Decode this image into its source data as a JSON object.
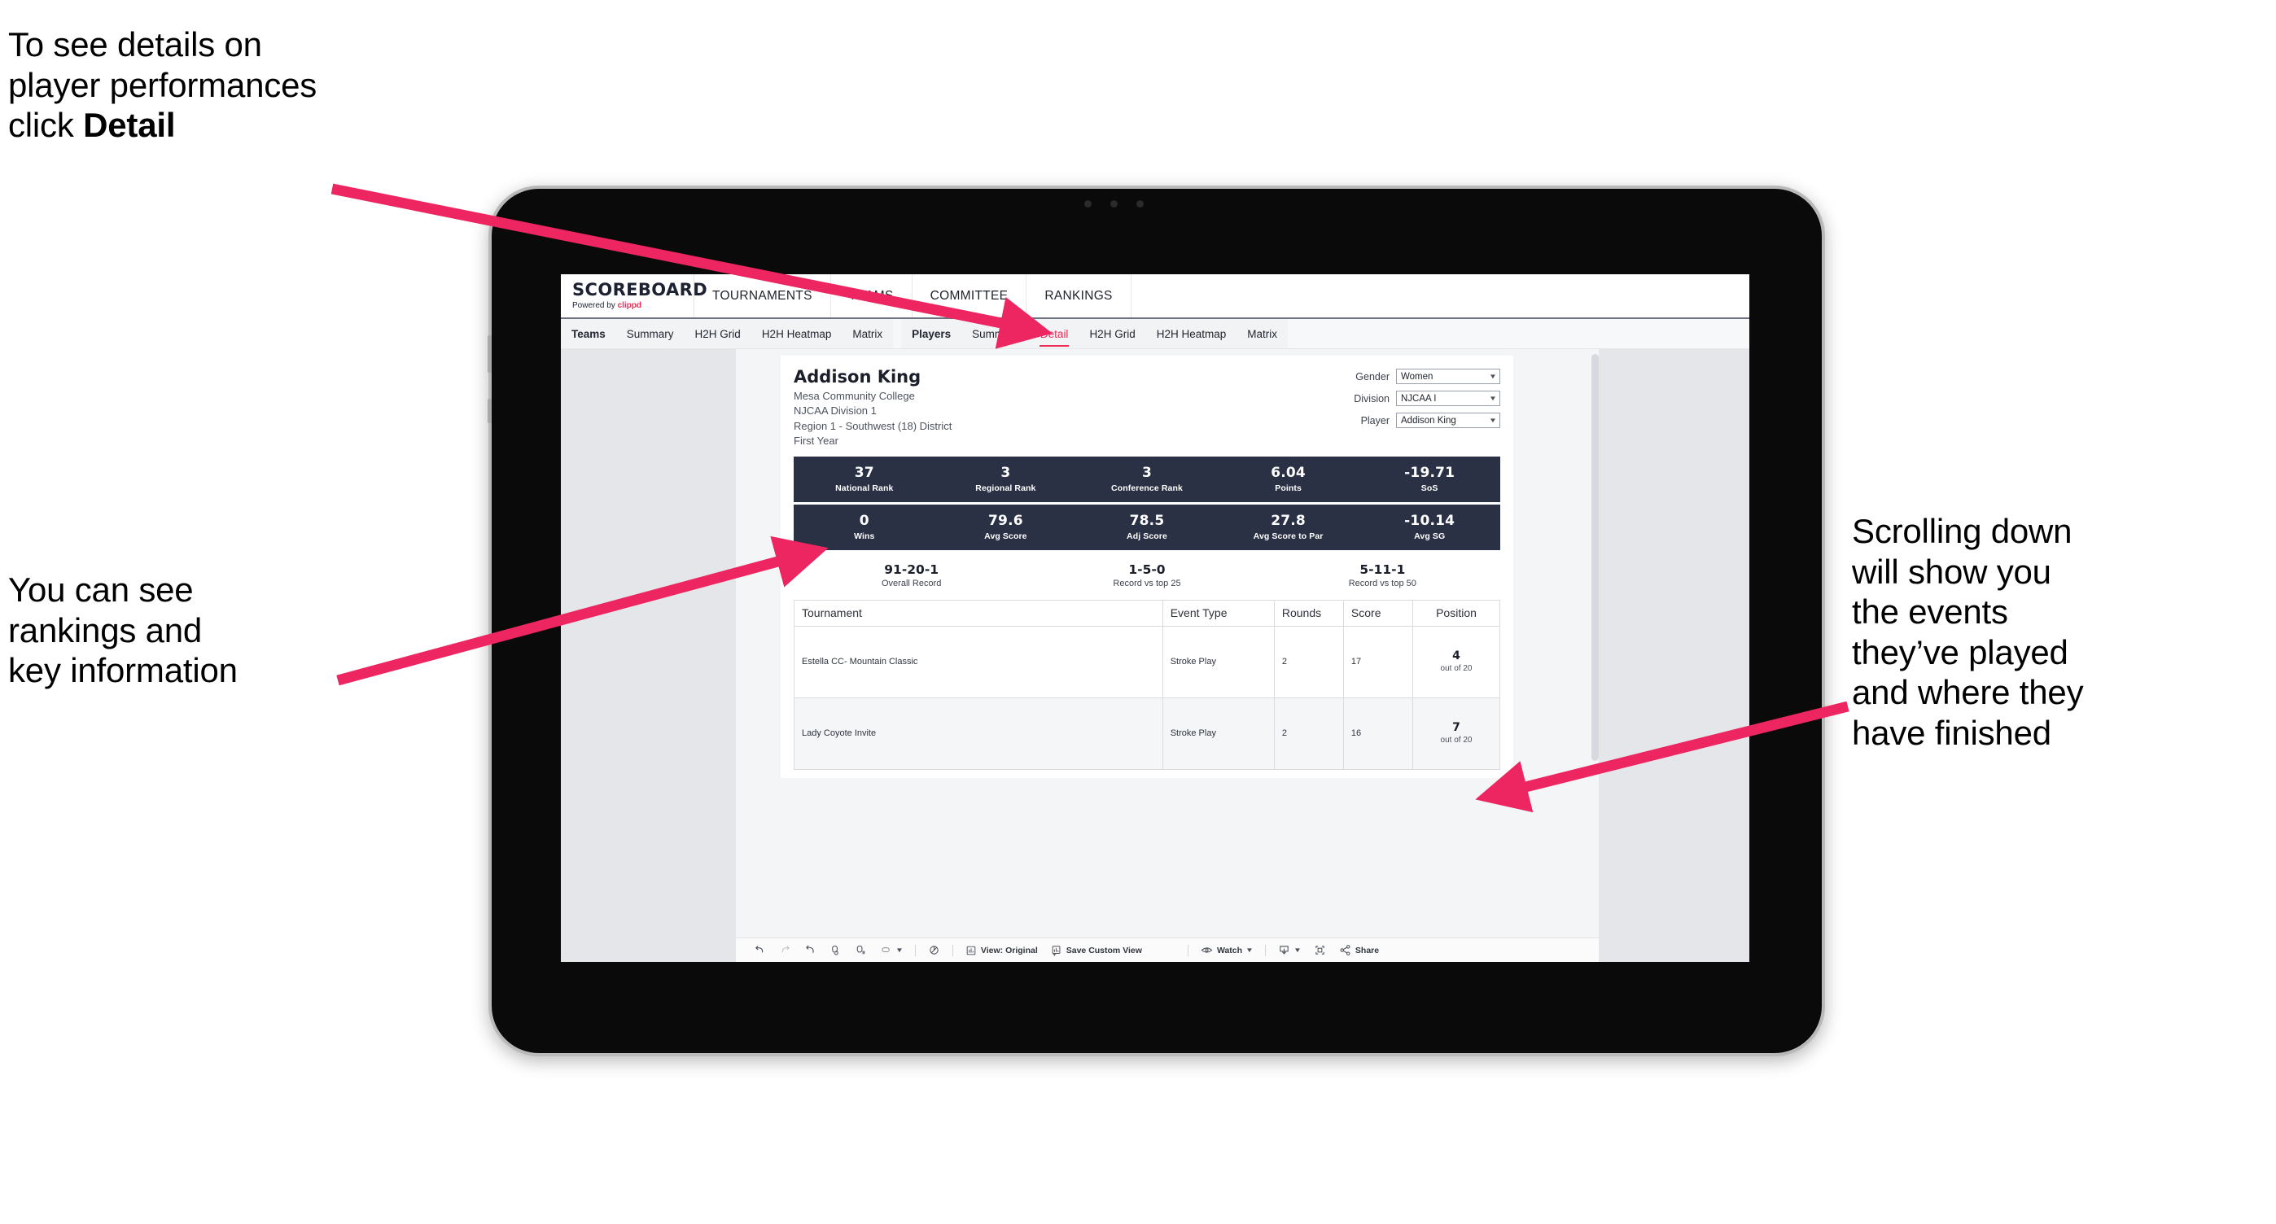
{
  "annotations": {
    "detail_line1": "To see details on",
    "detail_line2": "player performances",
    "detail_line3_pre": "click ",
    "detail_line3_bold": "Detail",
    "rankings_line1": "You can see",
    "rankings_line2": "rankings and",
    "rankings_line3": "key information",
    "scrolling_line1": "Scrolling down",
    "scrolling_line2": "will show you",
    "scrolling_line3": "the events",
    "scrolling_line4": "they’ve played",
    "scrolling_line5": "and where they",
    "scrolling_line6": "have finished",
    "arrow_color": "#ed2560"
  },
  "app": {
    "brand": {
      "name": "SCOREBOARD",
      "powered_by": "Powered by ",
      "clippd": "clippd"
    },
    "topnav": [
      "TOURNAMENTS",
      "TEAMS",
      "COMMITTEE",
      "RANKINGS"
    ],
    "subnav_teams": [
      "Teams",
      "Summary",
      "H2H Grid",
      "H2H Heatmap",
      "Matrix"
    ],
    "subnav_players": [
      "Players",
      "Summary",
      "Detail",
      "H2H Grid",
      "H2H Heatmap",
      "Matrix"
    ],
    "subnav_active": "Detail"
  },
  "player": {
    "name": "Addison King",
    "school": "Mesa Community College",
    "division": "NJCAA Division 1",
    "region": "Region 1 - Southwest (18) District",
    "year": "First Year"
  },
  "filters": [
    {
      "label": "Gender",
      "value": "Women"
    },
    {
      "label": "Division",
      "value": "NJCAA I"
    },
    {
      "label": "Player",
      "value": "Addison King"
    }
  ],
  "stats_row1": [
    {
      "value": "37",
      "label": "National Rank"
    },
    {
      "value": "3",
      "label": "Regional Rank"
    },
    {
      "value": "3",
      "label": "Conference Rank"
    },
    {
      "value": "6.04",
      "label": "Points"
    },
    {
      "value": "-19.71",
      "label": "SoS"
    }
  ],
  "stats_row2": [
    {
      "value": "0",
      "label": "Wins"
    },
    {
      "value": "79.6",
      "label": "Avg Score"
    },
    {
      "value": "78.5",
      "label": "Adj Score"
    },
    {
      "value": "27.8",
      "label": "Avg Score to Par"
    },
    {
      "value": "-10.14",
      "label": "Avg SG"
    }
  ],
  "records": [
    {
      "value": "91-20-1",
      "label": "Overall Record"
    },
    {
      "value": "1-5-0",
      "label": "Record vs top 25"
    },
    {
      "value": "5-11-1",
      "label": "Record vs top 50"
    }
  ],
  "table": {
    "headers": [
      "Tournament",
      "Event Type",
      "Rounds",
      "Score",
      "Position"
    ],
    "rows": [
      {
        "tournament": "Estella CC- Mountain Classic",
        "event_type": "Stroke Play",
        "rounds": "2",
        "score": "17",
        "position": "4",
        "position_sub": "out of 20"
      },
      {
        "tournament": "Lady Coyote Invite",
        "event_type": "Stroke Play",
        "rounds": "2",
        "score": "16",
        "position": "7",
        "position_sub": "out of 20"
      }
    ]
  },
  "toolbar": {
    "view_label": "View: Original",
    "save_label": "Save Custom View",
    "watch_label": "Watch",
    "share_label": "Share"
  },
  "colors": {
    "accent": "#ef2b57",
    "stat_bar": "#2b3145",
    "workspace": "#e4e6ea"
  }
}
